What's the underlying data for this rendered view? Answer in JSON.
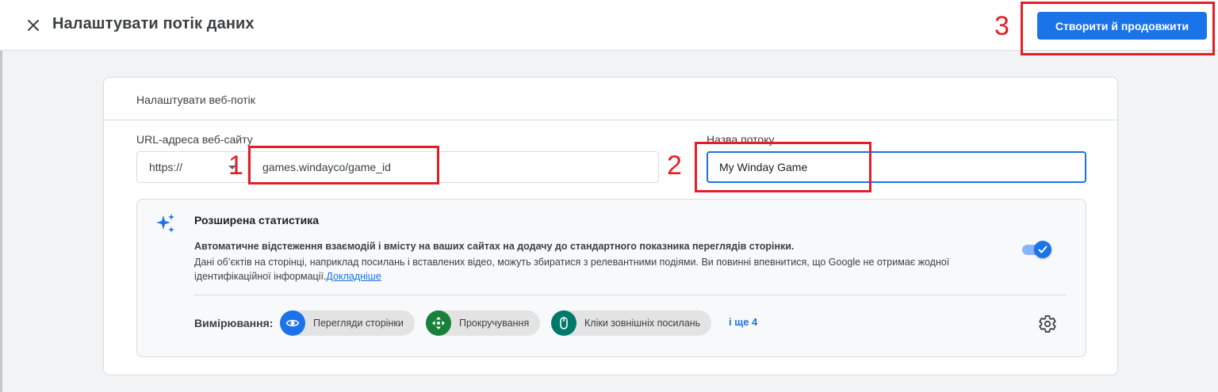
{
  "header": {
    "title": "Налаштувати потік даних",
    "close_icon": "close-icon",
    "primary_button": "Створити й продовжити"
  },
  "card": {
    "title": "Налаштувати веб-потік",
    "url_label": "URL-адреса веб-сайту",
    "protocol": "https://",
    "url_value": "games.windayco/game_id",
    "stream_name_label": "Назва потоку",
    "stream_name_value": "My Winday Game"
  },
  "enhanced": {
    "title": "Розширена статистика",
    "bold_text": "Автоматичне відстеження взаємодій і вмісту на ваших сайтах на додачу до стандартного показника переглядів сторінки.",
    "description": "Дані об’єктів на сторінці, наприклад посилань і вставлених відео, можуть збиратися з релевантними подіями. Ви повинні впевнитися, що Google не отримає жодної ідентифікаційної інформації.",
    "link": "Докладніше",
    "toggle_on": true,
    "measurement_label": "Вимірювання:",
    "chips": [
      {
        "label": "Перегляди сторінки",
        "icon": "eye-icon",
        "color": "#1a73e8"
      },
      {
        "label": "Прокручування",
        "icon": "scroll-arrows-icon",
        "color": "#188038"
      },
      {
        "label": "Кліки зовнішніх посилань",
        "icon": "mouse-icon",
        "color": "#00796b"
      }
    ],
    "more": "і ще 4"
  },
  "annotations": [
    "1",
    "2",
    "3"
  ],
  "colors": {
    "accent": "#1a73e8",
    "annotation": "#e41e26"
  }
}
